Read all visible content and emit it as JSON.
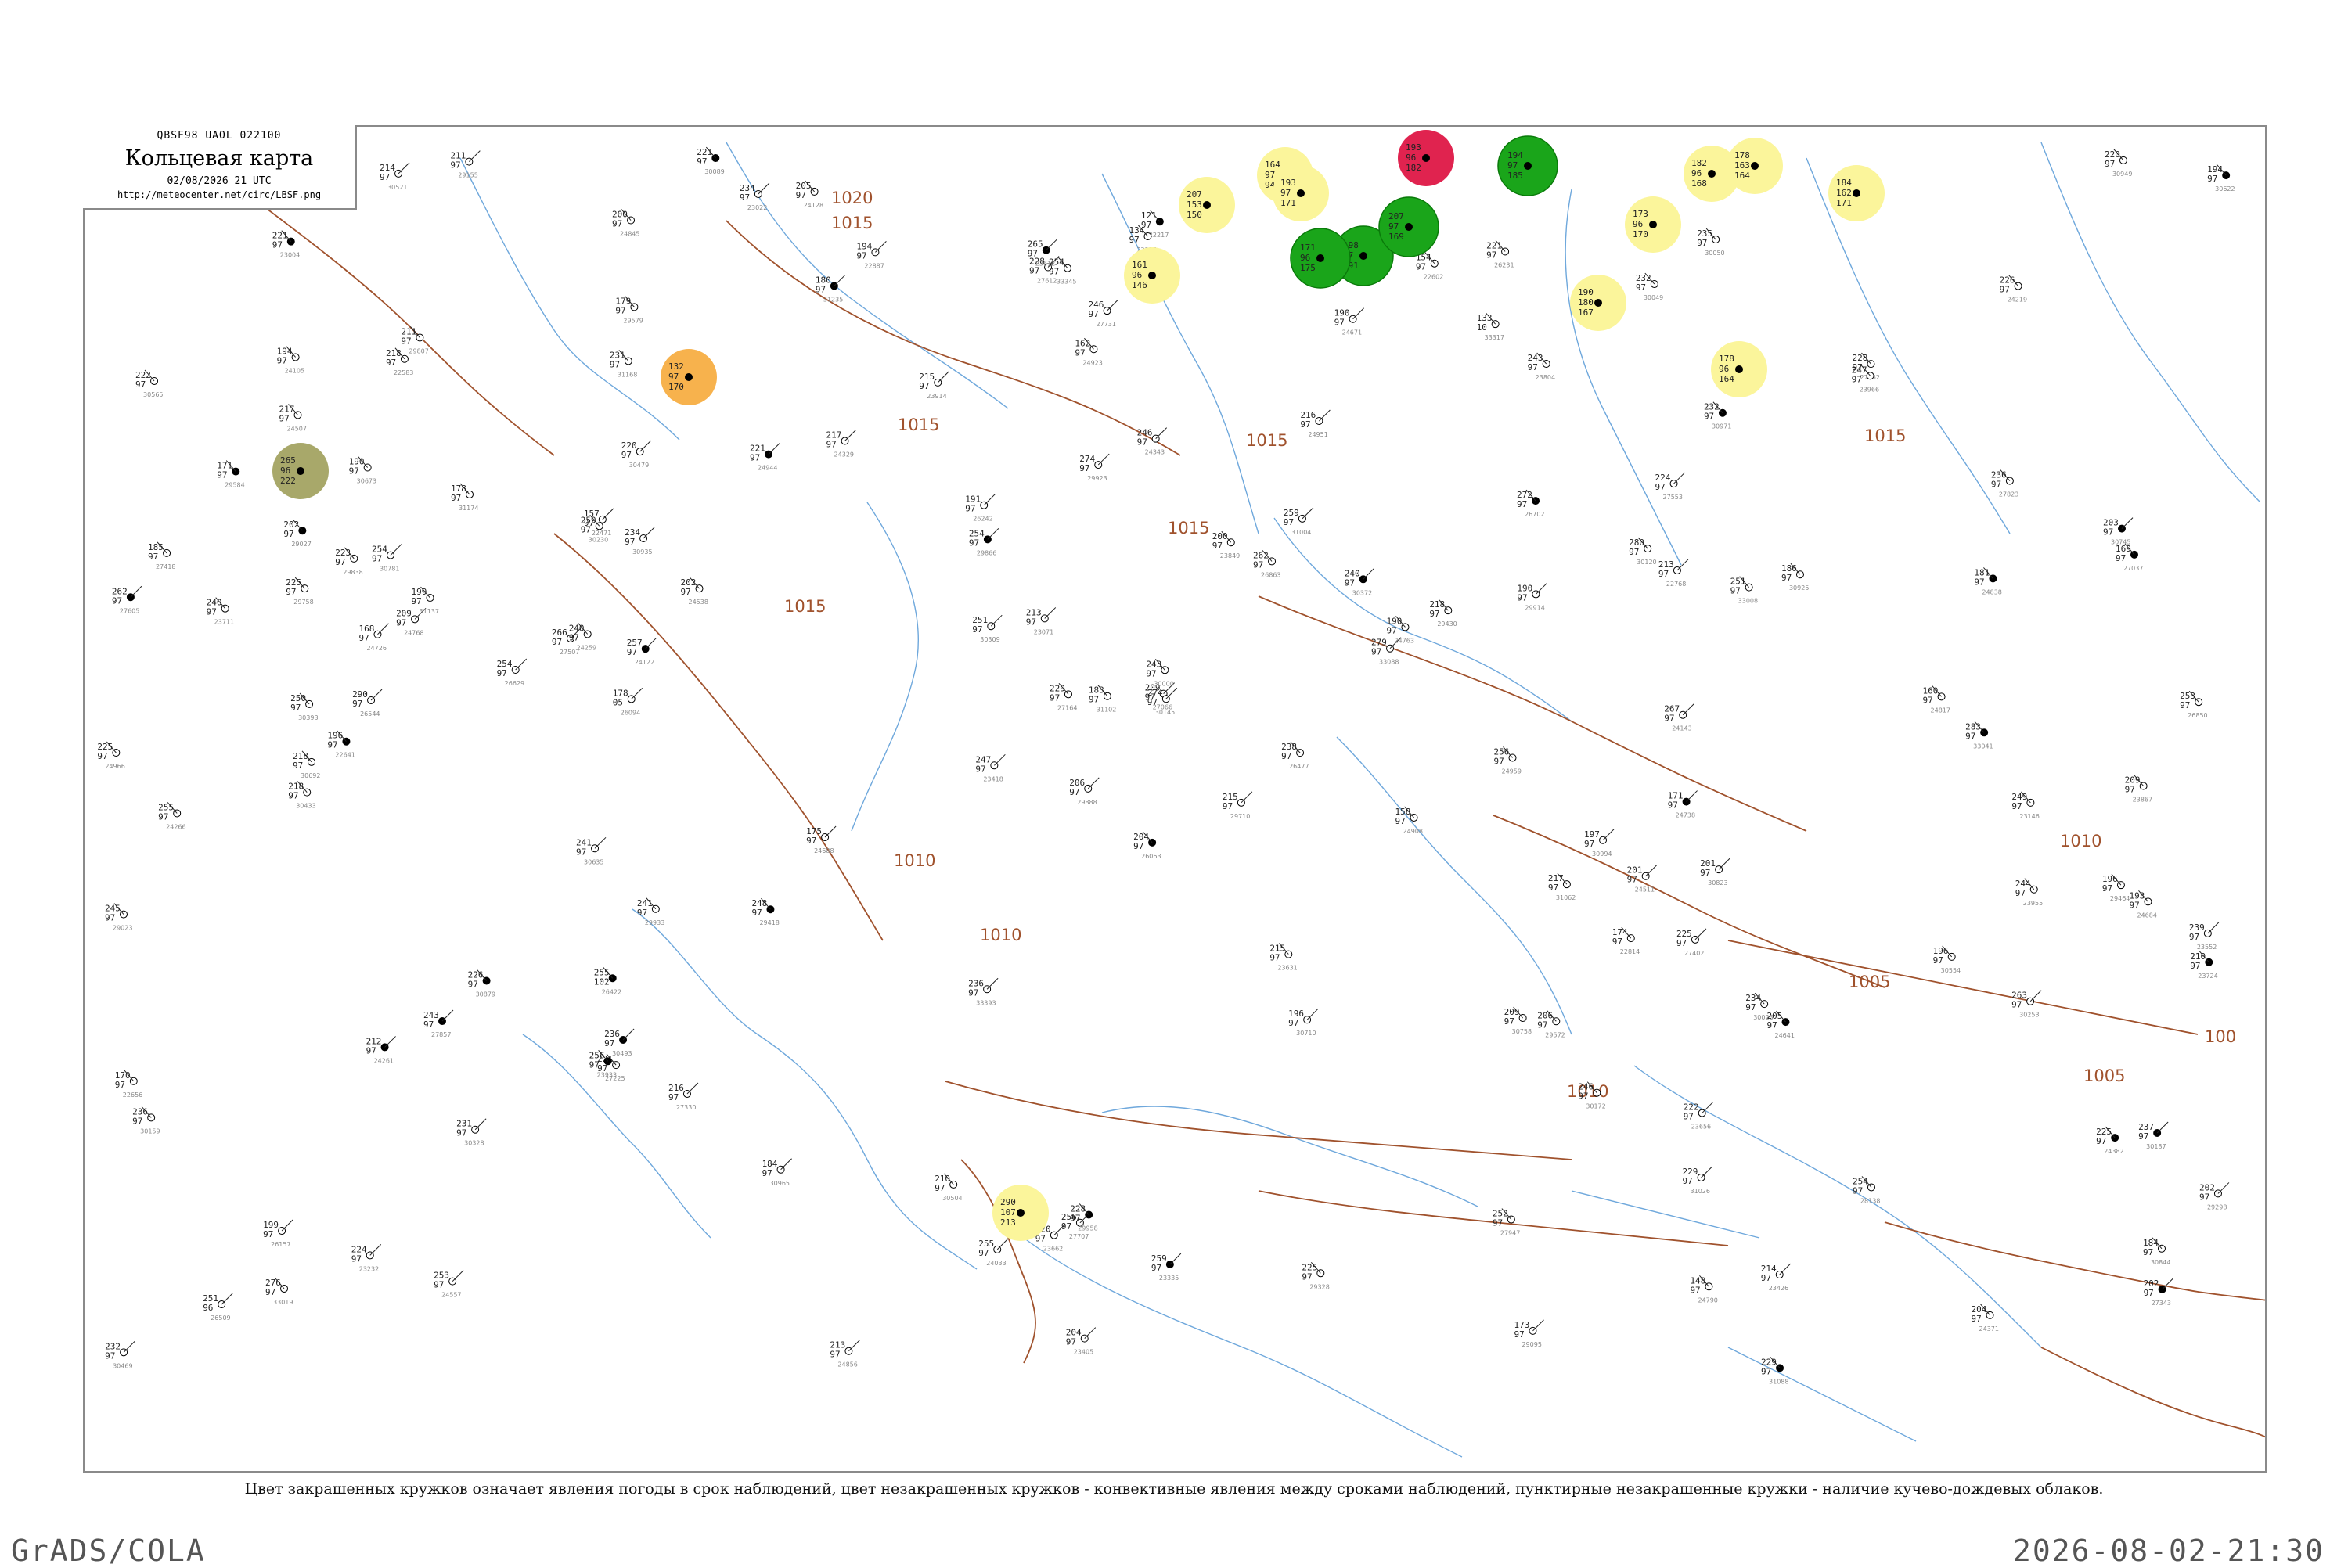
{
  "header": {
    "code": "QBSF98  UAOL  022100",
    "title": "Кольцевая карта",
    "datetime": "02/08/2026 21 UTC",
    "url": "http://meteocenter.net/circ/LBSF.png"
  },
  "caption": "Цвет закрашенных кружков означает явления погоды в срок наблюдений, цвет незакрашенных кружков - конвективные явления между сроками наблюдений, пунктирные незакрашенные кружки - наличие кучево-дождевых облаков.",
  "footer": {
    "left": "GrADS/COLA",
    "right": "2026-08-02-21:30"
  },
  "colors": {
    "isobar": "#a0522d",
    "water": "#6fa8dc",
    "frame": "#8a8a8a",
    "yellow": "#fbf59b",
    "green": "#1aa51a",
    "red": "#e0234f",
    "orange": "#f7b24d",
    "olive": "#a8a86a",
    "pink": "#d98a9a"
  },
  "isobar_labels": [
    {
      "text": "1015"
    },
    {
      "text": "1015"
    },
    {
      "text": "1015"
    },
    {
      "text": "1020"
    },
    {
      "text": "1015"
    },
    {
      "text": "1015"
    },
    {
      "text": "1015"
    },
    {
      "text": "1015"
    },
    {
      "text": "1010"
    },
    {
      "text": "1010"
    },
    {
      "text": "1010"
    },
    {
      "text": "1005"
    },
    {
      "text": "1005"
    },
    {
      "text": "1010"
    },
    {
      "text": "100"
    }
  ],
  "weather_markers": [
    {
      "kind": "yellow",
      "icon": "shower-icon",
      "values": [
        "164",
        "97",
        "94"
      ]
    },
    {
      "kind": "yellow",
      "icon": "shower-icon",
      "values": [
        "193",
        "97",
        "171"
      ]
    },
    {
      "kind": "yellow",
      "icon": "shower-icon",
      "values": [
        "207",
        "153",
        "150"
      ]
    },
    {
      "kind": "yellow",
      "icon": "shower-icon",
      "values": [
        "161",
        "96",
        "146"
      ]
    },
    {
      "kind": "yellow",
      "icon": "shower-icon",
      "values": [
        "182",
        "96",
        "168"
      ]
    },
    {
      "kind": "yellow",
      "icon": "shower-icon",
      "values": [
        "178",
        "163",
        "164"
      ]
    },
    {
      "kind": "yellow",
      "icon": "shower-icon",
      "values": [
        "184",
        "162",
        "171"
      ]
    },
    {
      "kind": "yellow",
      "icon": "shower-icon",
      "values": [
        "173",
        "96",
        "170"
      ]
    },
    {
      "kind": "yellow",
      "icon": "shower-icon",
      "values": [
        "190",
        "180",
        "167"
      ]
    },
    {
      "kind": "yellow",
      "icon": "shower-icon",
      "values": [
        "178",
        "96",
        "164"
      ]
    },
    {
      "kind": "yellow",
      "icon": "shower-icon",
      "values": [
        "290",
        "107",
        "213"
      ]
    },
    {
      "kind": "green",
      "icon": "rain-icon",
      "values": [
        "198",
        "97",
        "191"
      ]
    },
    {
      "kind": "green",
      "icon": "rain-icon",
      "values": [
        "171",
        "96",
        "175"
      ]
    },
    {
      "kind": "green",
      "icon": "rain-icon",
      "values": [
        "207",
        "97",
        "169"
      ]
    },
    {
      "kind": "green",
      "icon": "rain-icon",
      "values": [
        "194",
        "97",
        "185"
      ]
    },
    {
      "kind": "red",
      "icon": "thunderstorm-icon",
      "values": [
        "193",
        "96",
        "182"
      ]
    },
    {
      "kind": "orange",
      "icon": "drizzle-icon",
      "values": [
        "132",
        "97",
        "170"
      ]
    },
    {
      "kind": "olive",
      "icon": "haze-icon",
      "values": [
        "265",
        "96",
        "222"
      ]
    }
  ],
  "stations": [
    {
      "n": [
        "204",
        "97"
      ],
      "id": "26063"
    },
    {
      "n": [
        "178",
        "05"
      ],
      "id": "26094"
    },
    {
      "n": [
        "199",
        "97"
      ],
      "id": "26157"
    },
    {
      "n": [
        "191",
        "97"
      ],
      "id": "26242"
    },
    {
      "n": [
        "221",
        "97"
      ],
      "id": "26231"
    },
    {
      "n": [
        "255",
        "102"
      ],
      "id": "26422"
    },
    {
      "n": [
        "238",
        "97"
      ],
      "id": "26477"
    },
    {
      "n": [
        "251",
        "96"
      ],
      "id": "26509"
    },
    {
      "n": [
        "290",
        "97"
      ],
      "id": "26544"
    },
    {
      "n": [
        "254",
        "97"
      ],
      "id": "26629"
    },
    {
      "n": [
        "272",
        "97"
      ],
      "id": "26702"
    },
    {
      "n": [
        "253",
        "97"
      ],
      "id": "26850"
    },
    {
      "n": [
        "262",
        "97"
      ],
      "id": "26863"
    },
    {
      "n": [
        "251",
        "97"
      ],
      "id": "33008"
    },
    {
      "n": [
        "276",
        "97"
      ],
      "id": "33019"
    },
    {
      "n": [
        "283",
        "97"
      ],
      "id": "33041"
    },
    {
      "n": [
        "279",
        "97"
      ],
      "id": "33088"
    },
    {
      "n": [
        "133",
        "10"
      ],
      "id": "33317"
    },
    {
      "n": [
        "254",
        "97"
      ],
      "id": "33345"
    },
    {
      "n": [
        "236",
        "97"
      ],
      "id": "33393"
    },
    {
      "n": [
        "169",
        "97"
      ],
      "id": "27037"
    },
    {
      "n": [
        "209",
        "97"
      ],
      "id": "27066"
    },
    {
      "n": [
        "229",
        "97"
      ],
      "id": "27164"
    },
    {
      "n": [
        "221",
        "97"
      ],
      "id": "27225"
    },
    {
      "n": [
        "216",
        "97"
      ],
      "id": "27330"
    },
    {
      "n": [
        "202",
        "97"
      ],
      "id": "27343"
    },
    {
      "n": [
        "225",
        "97"
      ],
      "id": "27402"
    },
    {
      "n": [
        "185",
        "97"
      ],
      "id": "27418"
    },
    {
      "n": [
        "266",
        "97"
      ],
      "id": "27507"
    },
    {
      "n": [
        "224",
        "97"
      ],
      "id": "27553"
    },
    {
      "n": [
        "262",
        "97"
      ],
      "id": "27605"
    },
    {
      "n": [
        "228",
        "97"
      ],
      "id": "27612"
    },
    {
      "n": [
        "256",
        "97"
      ],
      "id": "27707"
    },
    {
      "n": [
        "246",
        "97"
      ],
      "id": "27731"
    },
    {
      "n": [
        "236",
        "97"
      ],
      "id": "27823"
    },
    {
      "n": [
        "243",
        "97"
      ],
      "id": "27857"
    },
    {
      "n": [
        "252",
        "97"
      ],
      "id": "27947"
    },
    {
      "n": [
        "228",
        "97"
      ],
      "id": "27962"
    },
    {
      "n": [
        "232",
        "97"
      ],
      "id": "28009"
    },
    {
      "n": [
        "254",
        "97"
      ],
      "id": "28138"
    },
    {
      "n": [
        "121",
        "97"
      ],
      "id": "22217"
    },
    {
      "n": [
        "134",
        "97"
      ],
      "id": "22355"
    },
    {
      "n": [
        "157",
        "97"
      ],
      "id": "22471"
    },
    {
      "n": [
        "218",
        "97"
      ],
      "id": "22583"
    },
    {
      "n": [
        "154",
        "97"
      ],
      "id": "22602"
    },
    {
      "n": [
        "196",
        "97"
      ],
      "id": "22641"
    },
    {
      "n": [
        "170",
        "97"
      ],
      "id": "22656"
    },
    {
      "n": [
        "213",
        "97"
      ],
      "id": "22768"
    },
    {
      "n": [
        "174",
        "97"
      ],
      "id": "22814"
    },
    {
      "n": [
        "194",
        "97"
      ],
      "id": "22887"
    },
    {
      "n": [
        "221",
        "97"
      ],
      "id": "23004"
    },
    {
      "n": [
        "234",
        "97"
      ],
      "id": "23022"
    },
    {
      "n": [
        "213",
        "97"
      ],
      "id": "23071"
    },
    {
      "n": [
        "249",
        "97"
      ],
      "id": "23146"
    },
    {
      "n": [
        "224",
        "97"
      ],
      "id": "23232"
    },
    {
      "n": [
        "259",
        "97"
      ],
      "id": "23335"
    },
    {
      "n": [
        "204",
        "97"
      ],
      "id": "23405"
    },
    {
      "n": [
        "247",
        "97"
      ],
      "id": "23418"
    },
    {
      "n": [
        "214",
        "97"
      ],
      "id": "23426"
    },
    {
      "n": [
        "239",
        "97"
      ],
      "id": "23552"
    },
    {
      "n": [
        "265",
        "97"
      ],
      "id": "23612"
    },
    {
      "n": [
        "215",
        "97"
      ],
      "id": "23631"
    },
    {
      "n": [
        "222",
        "97"
      ],
      "id": "23656"
    },
    {
      "n": [
        "220",
        "97"
      ],
      "id": "23662"
    },
    {
      "n": [
        "240",
        "97"
      ],
      "id": "23711"
    },
    {
      "n": [
        "210",
        "97"
      ],
      "id": "23724"
    },
    {
      "n": [
        "243",
        "97"
      ],
      "id": "23804"
    },
    {
      "n": [
        "200",
        "97"
      ],
      "id": "23849"
    },
    {
      "n": [
        "209",
        "97"
      ],
      "id": "23867"
    },
    {
      "n": [
        "215",
        "97"
      ],
      "id": "23914"
    },
    {
      "n": [
        "256",
        "97"
      ],
      "id": "23933"
    },
    {
      "n": [
        "244",
        "97"
      ],
      "id": "23955"
    },
    {
      "n": [
        "247",
        "97"
      ],
      "id": "23966"
    },
    {
      "n": [
        "255",
        "97"
      ],
      "id": "24033"
    },
    {
      "n": [
        "194",
        "97"
      ],
      "id": "24105"
    },
    {
      "n": [
        "257",
        "97"
      ],
      "id": "24122"
    },
    {
      "n": [
        "205",
        "97"
      ],
      "id": "24128"
    },
    {
      "n": [
        "267",
        "97"
      ],
      "id": "24143"
    },
    {
      "n": [
        "226",
        "97"
      ],
      "id": "24219"
    },
    {
      "n": [
        "240",
        "97"
      ],
      "id": "24259"
    },
    {
      "n": [
        "212",
        "97"
      ],
      "id": "24261"
    },
    {
      "n": [
        "255",
        "97"
      ],
      "id": "24266"
    },
    {
      "n": [
        "217",
        "97"
      ],
      "id": "24329"
    },
    {
      "n": [
        "246",
        "97"
      ],
      "id": "24343"
    },
    {
      "n": [
        "204",
        "97"
      ],
      "id": "24371"
    },
    {
      "n": [
        "225",
        "97"
      ],
      "id": "24382"
    },
    {
      "n": [
        "217",
        "97"
      ],
      "id": "24507"
    },
    {
      "n": [
        "201",
        "97"
      ],
      "id": "24511"
    },
    {
      "n": [
        "202",
        "97"
      ],
      "id": "24538"
    },
    {
      "n": [
        "253",
        "97"
      ],
      "id": "24557"
    },
    {
      "n": [
        "205",
        "97"
      ],
      "id": "24641"
    },
    {
      "n": [
        "190",
        "97"
      ],
      "id": "24671"
    },
    {
      "n": [
        "193",
        "97"
      ],
      "id": "24684"
    },
    {
      "n": [
        "175",
        "97"
      ],
      "id": "24688"
    },
    {
      "n": [
        "168",
        "97"
      ],
      "id": "24726"
    },
    {
      "n": [
        "171",
        "97"
      ],
      "id": "24738"
    },
    {
      "n": [
        "190",
        "97"
      ],
      "id": "24763"
    },
    {
      "n": [
        "209",
        "97"
      ],
      "id": "24768"
    },
    {
      "n": [
        "148",
        "97"
      ],
      "id": "24790"
    },
    {
      "n": [
        "160",
        "97"
      ],
      "id": "24817"
    },
    {
      "n": [
        "181",
        "97"
      ],
      "id": "24838"
    },
    {
      "n": [
        "200",
        "97"
      ],
      "id": "24845"
    },
    {
      "n": [
        "213",
        "97"
      ],
      "id": "24856"
    },
    {
      "n": [
        "158",
        "97"
      ],
      "id": "24908"
    },
    {
      "n": [
        "162",
        "97"
      ],
      "id": "24923"
    },
    {
      "n": [
        "221",
        "97"
      ],
      "id": "24944"
    },
    {
      "n": [
        "216",
        "97"
      ],
      "id": "24951"
    },
    {
      "n": [
        "256",
        "97"
      ],
      "id": "24959"
    },
    {
      "n": [
        "225",
        "97"
      ],
      "id": "24966"
    },
    {
      "n": [
        "245",
        "97"
      ],
      "id": "29023"
    },
    {
      "n": [
        "202",
        "97"
      ],
      "id": "29027"
    },
    {
      "n": [
        "173",
        "97"
      ],
      "id": "29095"
    },
    {
      "n": [
        "211",
        "97"
      ],
      "id": "29155"
    },
    {
      "n": [
        "202",
        "97"
      ],
      "id": "29298"
    },
    {
      "n": [
        "225",
        "97"
      ],
      "id": "29328"
    },
    {
      "n": [
        "248",
        "97"
      ],
      "id": "29418"
    },
    {
      "n": [
        "218",
        "97"
      ],
      "id": "29430"
    },
    {
      "n": [
        "196",
        "97"
      ],
      "id": "29464"
    },
    {
      "n": [
        "206",
        "97"
      ],
      "id": "29572"
    },
    {
      "n": [
        "179",
        "97"
      ],
      "id": "29579"
    },
    {
      "n": [
        "171",
        "97"
      ],
      "id": "29584"
    },
    {
      "n": [
        "215",
        "97"
      ],
      "id": "29710"
    },
    {
      "n": [
        "225",
        "97"
      ],
      "id": "29758"
    },
    {
      "n": [
        "211",
        "97"
      ],
      "id": "29807"
    },
    {
      "n": [
        "223",
        "97"
      ],
      "id": "29838"
    },
    {
      "n": [
        "254",
        "97"
      ],
      "id": "29866"
    },
    {
      "n": [
        "206",
        "97"
      ],
      "id": "29888"
    },
    {
      "n": [
        "190",
        "97"
      ],
      "id": "29914"
    },
    {
      "n": [
        "274",
        "97"
      ],
      "id": "29923"
    },
    {
      "n": [
        "241",
        "97"
      ],
      "id": "29933"
    },
    {
      "n": [
        "228",
        "97"
      ],
      "id": "29958"
    },
    {
      "n": [
        "243",
        "97"
      ],
      "id": "30000"
    },
    {
      "n": [
        "234",
        "97"
      ],
      "id": "30023"
    },
    {
      "n": [
        "232",
        "97"
      ],
      "id": "30049"
    },
    {
      "n": [
        "235",
        "97"
      ],
      "id": "30050"
    },
    {
      "n": [
        "221",
        "97"
      ],
      "id": "30089"
    },
    {
      "n": [
        "280",
        "97"
      ],
      "id": "30120"
    },
    {
      "n": [
        "274",
        "97"
      ],
      "id": "30145"
    },
    {
      "n": [
        "236",
        "97"
      ],
      "id": "30159"
    },
    {
      "n": [
        "246",
        "97"
      ],
      "id": "30172"
    },
    {
      "n": [
        "237",
        "97"
      ],
      "id": "30187"
    },
    {
      "n": [
        "259",
        "97"
      ],
      "id": "30230"
    },
    {
      "n": [
        "263",
        "97"
      ],
      "id": "30253"
    },
    {
      "n": [
        "251",
        "97"
      ],
      "id": "30309"
    },
    {
      "n": [
        "231",
        "97"
      ],
      "id": "30328"
    },
    {
      "n": [
        "240",
        "97"
      ],
      "id": "30372"
    },
    {
      "n": [
        "250",
        "97"
      ],
      "id": "30393"
    },
    {
      "n": [
        "218",
        "97"
      ],
      "id": "30433"
    },
    {
      "n": [
        "232",
        "97"
      ],
      "id": "30469"
    },
    {
      "n": [
        "220",
        "97"
      ],
      "id": "30479"
    },
    {
      "n": [
        "236",
        "97"
      ],
      "id": "30493"
    },
    {
      "n": [
        "210",
        "97"
      ],
      "id": "30504"
    },
    {
      "n": [
        "214",
        "97"
      ],
      "id": "30521"
    },
    {
      "n": [
        "196",
        "97"
      ],
      "id": "30554"
    },
    {
      "n": [
        "222",
        "97"
      ],
      "id": "30565"
    },
    {
      "n": [
        "194",
        "97"
      ],
      "id": "30622"
    },
    {
      "n": [
        "241",
        "97"
      ],
      "id": "30635"
    },
    {
      "n": [
        "190",
        "97"
      ],
      "id": "30673"
    },
    {
      "n": [
        "218",
        "97"
      ],
      "id": "30692"
    },
    {
      "n": [
        "196",
        "97"
      ],
      "id": "30710"
    },
    {
      "n": [
        "203",
        "97"
      ],
      "id": "30745"
    },
    {
      "n": [
        "209",
        "97"
      ],
      "id": "30758"
    },
    {
      "n": [
        "254",
        "97"
      ],
      "id": "30781"
    },
    {
      "n": [
        "201",
        "97"
      ],
      "id": "30823"
    },
    {
      "n": [
        "184",
        "97"
      ],
      "id": "30844"
    },
    {
      "n": [
        "226",
        "97"
      ],
      "id": "30879"
    },
    {
      "n": [
        "186",
        "97"
      ],
      "id": "30925"
    },
    {
      "n": [
        "234",
        "97"
      ],
      "id": "30935"
    },
    {
      "n": [
        "220",
        "97"
      ],
      "id": "30949"
    },
    {
      "n": [
        "184",
        "97"
      ],
      "id": "30965"
    },
    {
      "n": [
        "232",
        "97"
      ],
      "id": "30971"
    },
    {
      "n": [
        "197",
        "97"
      ],
      "id": "30994"
    },
    {
      "n": [
        "259",
        "97"
      ],
      "id": "31004"
    },
    {
      "n": [
        "229",
        "97"
      ],
      "id": "31026"
    },
    {
      "n": [
        "217",
        "97"
      ],
      "id": "31062"
    },
    {
      "n": [
        "229",
        "97"
      ],
      "id": "31088"
    },
    {
      "n": [
        "183",
        "97"
      ],
      "id": "31102"
    },
    {
      "n": [
        "199",
        "97"
      ],
      "id": "31137"
    },
    {
      "n": [
        "231",
        "97"
      ],
      "id": "31168"
    },
    {
      "n": [
        "178",
        "97"
      ],
      "id": "31174"
    },
    {
      "n": [
        "180",
        "97"
      ],
      "id": "31235"
    }
  ]
}
